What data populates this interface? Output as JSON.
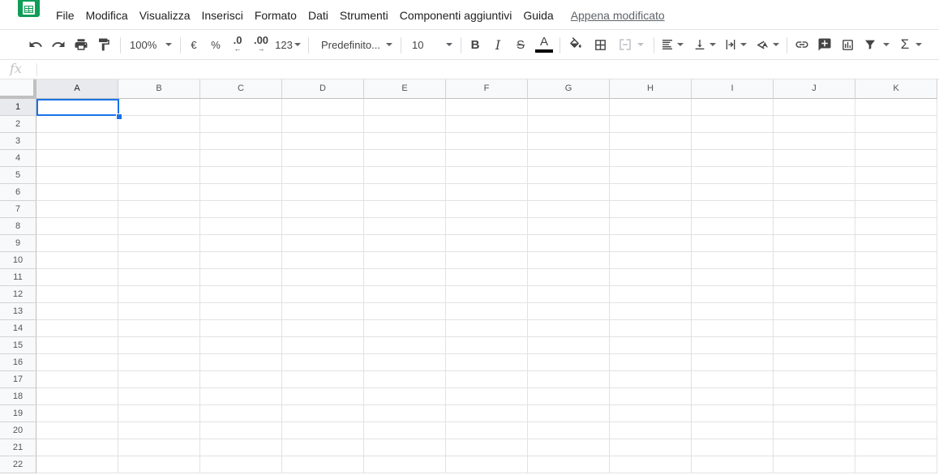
{
  "menu": {
    "items": [
      "File",
      "Modifica",
      "Visualizza",
      "Inserisci",
      "Formato",
      "Dati",
      "Strumenti",
      "Componenti aggiuntivi",
      "Guida"
    ],
    "last_edit": "Appena modificato"
  },
  "toolbar": {
    "zoom": "100%",
    "currency": "€",
    "percent": "%",
    "decrease_decimals": ".0",
    "increase_decimals": ".00",
    "more_formats": "123",
    "font": "Predefinito...",
    "font_size": "10",
    "text_color": "#000000"
  },
  "formula_bar": {
    "fx_label": "fx",
    "value": ""
  },
  "sheet": {
    "columns": [
      "A",
      "B",
      "C",
      "D",
      "E",
      "F",
      "G",
      "H",
      "I",
      "J",
      "K"
    ],
    "rows": [
      "1",
      "2",
      "3",
      "4",
      "5",
      "6",
      "7",
      "8",
      "9",
      "10",
      "11",
      "12",
      "13",
      "14",
      "15",
      "16",
      "17",
      "18",
      "19",
      "20",
      "21",
      "22"
    ],
    "selected_cell": "A1"
  },
  "colors": {
    "brand": "#0f9d58",
    "selection": "#1a73e8"
  },
  "icons": [
    "sheets-logo-icon",
    "undo-icon",
    "redo-icon",
    "print-icon",
    "paint-format-icon",
    "bold-icon",
    "italic-icon",
    "strikethrough-icon",
    "text-color-icon",
    "fill-color-icon",
    "borders-icon",
    "merge-cells-icon",
    "horizontal-align-icon",
    "vertical-align-icon",
    "text-wrap-icon",
    "text-rotation-icon",
    "link-icon",
    "insert-comment-icon",
    "insert-chart-icon",
    "filter-icon",
    "functions-icon"
  ]
}
